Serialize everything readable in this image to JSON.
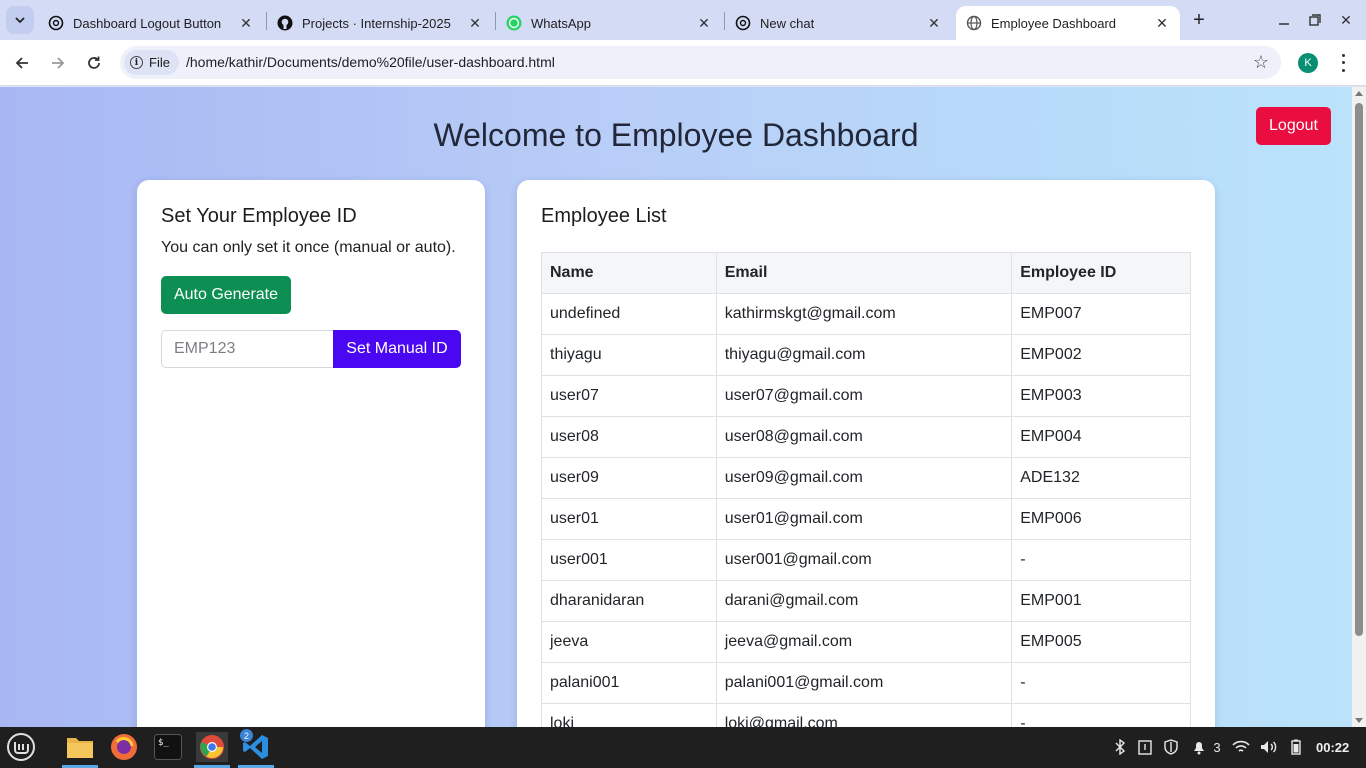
{
  "browser": {
    "tabs": [
      {
        "title": "Dashboard Logout Button",
        "icon": "openai-icon"
      },
      {
        "title": "Projects · Internship-2025",
        "icon": "github-icon"
      },
      {
        "title": "WhatsApp",
        "icon": "whatsapp-icon"
      },
      {
        "title": "New chat",
        "icon": "openai-icon"
      },
      {
        "title": "Employee Dashboard",
        "icon": "globe-icon",
        "active": true
      }
    ],
    "url_chip": "File",
    "url": "/home/kathir/Documents/demo%20file/user-dashboard.html",
    "profile_initial": "K"
  },
  "page": {
    "title": "Welcome to Employee Dashboard",
    "logout_label": "Logout",
    "colors": {
      "logout": "#e90d40",
      "auto_generate": "#0d8f53",
      "set_manual": "#4a08f2"
    }
  },
  "set_id": {
    "heading": "Set Your Employee ID",
    "note": "You can only set it once (manual or auto).",
    "auto_label": "Auto Generate",
    "input_placeholder": "EMP123",
    "input_value": "",
    "manual_label": "Set Manual ID"
  },
  "employee_list": {
    "heading": "Employee List",
    "columns": [
      "Name",
      "Email",
      "Employee ID"
    ],
    "rows": [
      [
        "undefined",
        "kathirmskgt@gmail.com",
        "EMP007"
      ],
      [
        "thiyagu",
        "thiyagu@gmail.com",
        "EMP002"
      ],
      [
        "user07",
        "user07@gmail.com",
        "EMP003"
      ],
      [
        "user08",
        "user08@gmail.com",
        "EMP004"
      ],
      [
        "user09",
        "user09@gmail.com",
        "ADE132"
      ],
      [
        "user01",
        "user01@gmail.com",
        "EMP006"
      ],
      [
        "user001",
        "user001@gmail.com",
        "-"
      ],
      [
        "dharanidaran",
        "darani@gmail.com",
        "EMP001"
      ],
      [
        "jeeva",
        "jeeva@gmail.com",
        "EMP005"
      ],
      [
        "palani001",
        "palani001@gmail.com",
        "-"
      ],
      [
        "loki",
        "loki@gmail.com",
        "-"
      ]
    ]
  },
  "taskbar": {
    "apps": [
      "mint-menu-icon",
      "files-icon",
      "firefox-icon",
      "terminal-icon",
      "chrome-icon",
      "vscode-icon"
    ],
    "vscode_badge": "2",
    "notification_count": "3",
    "clock": "00:22"
  }
}
